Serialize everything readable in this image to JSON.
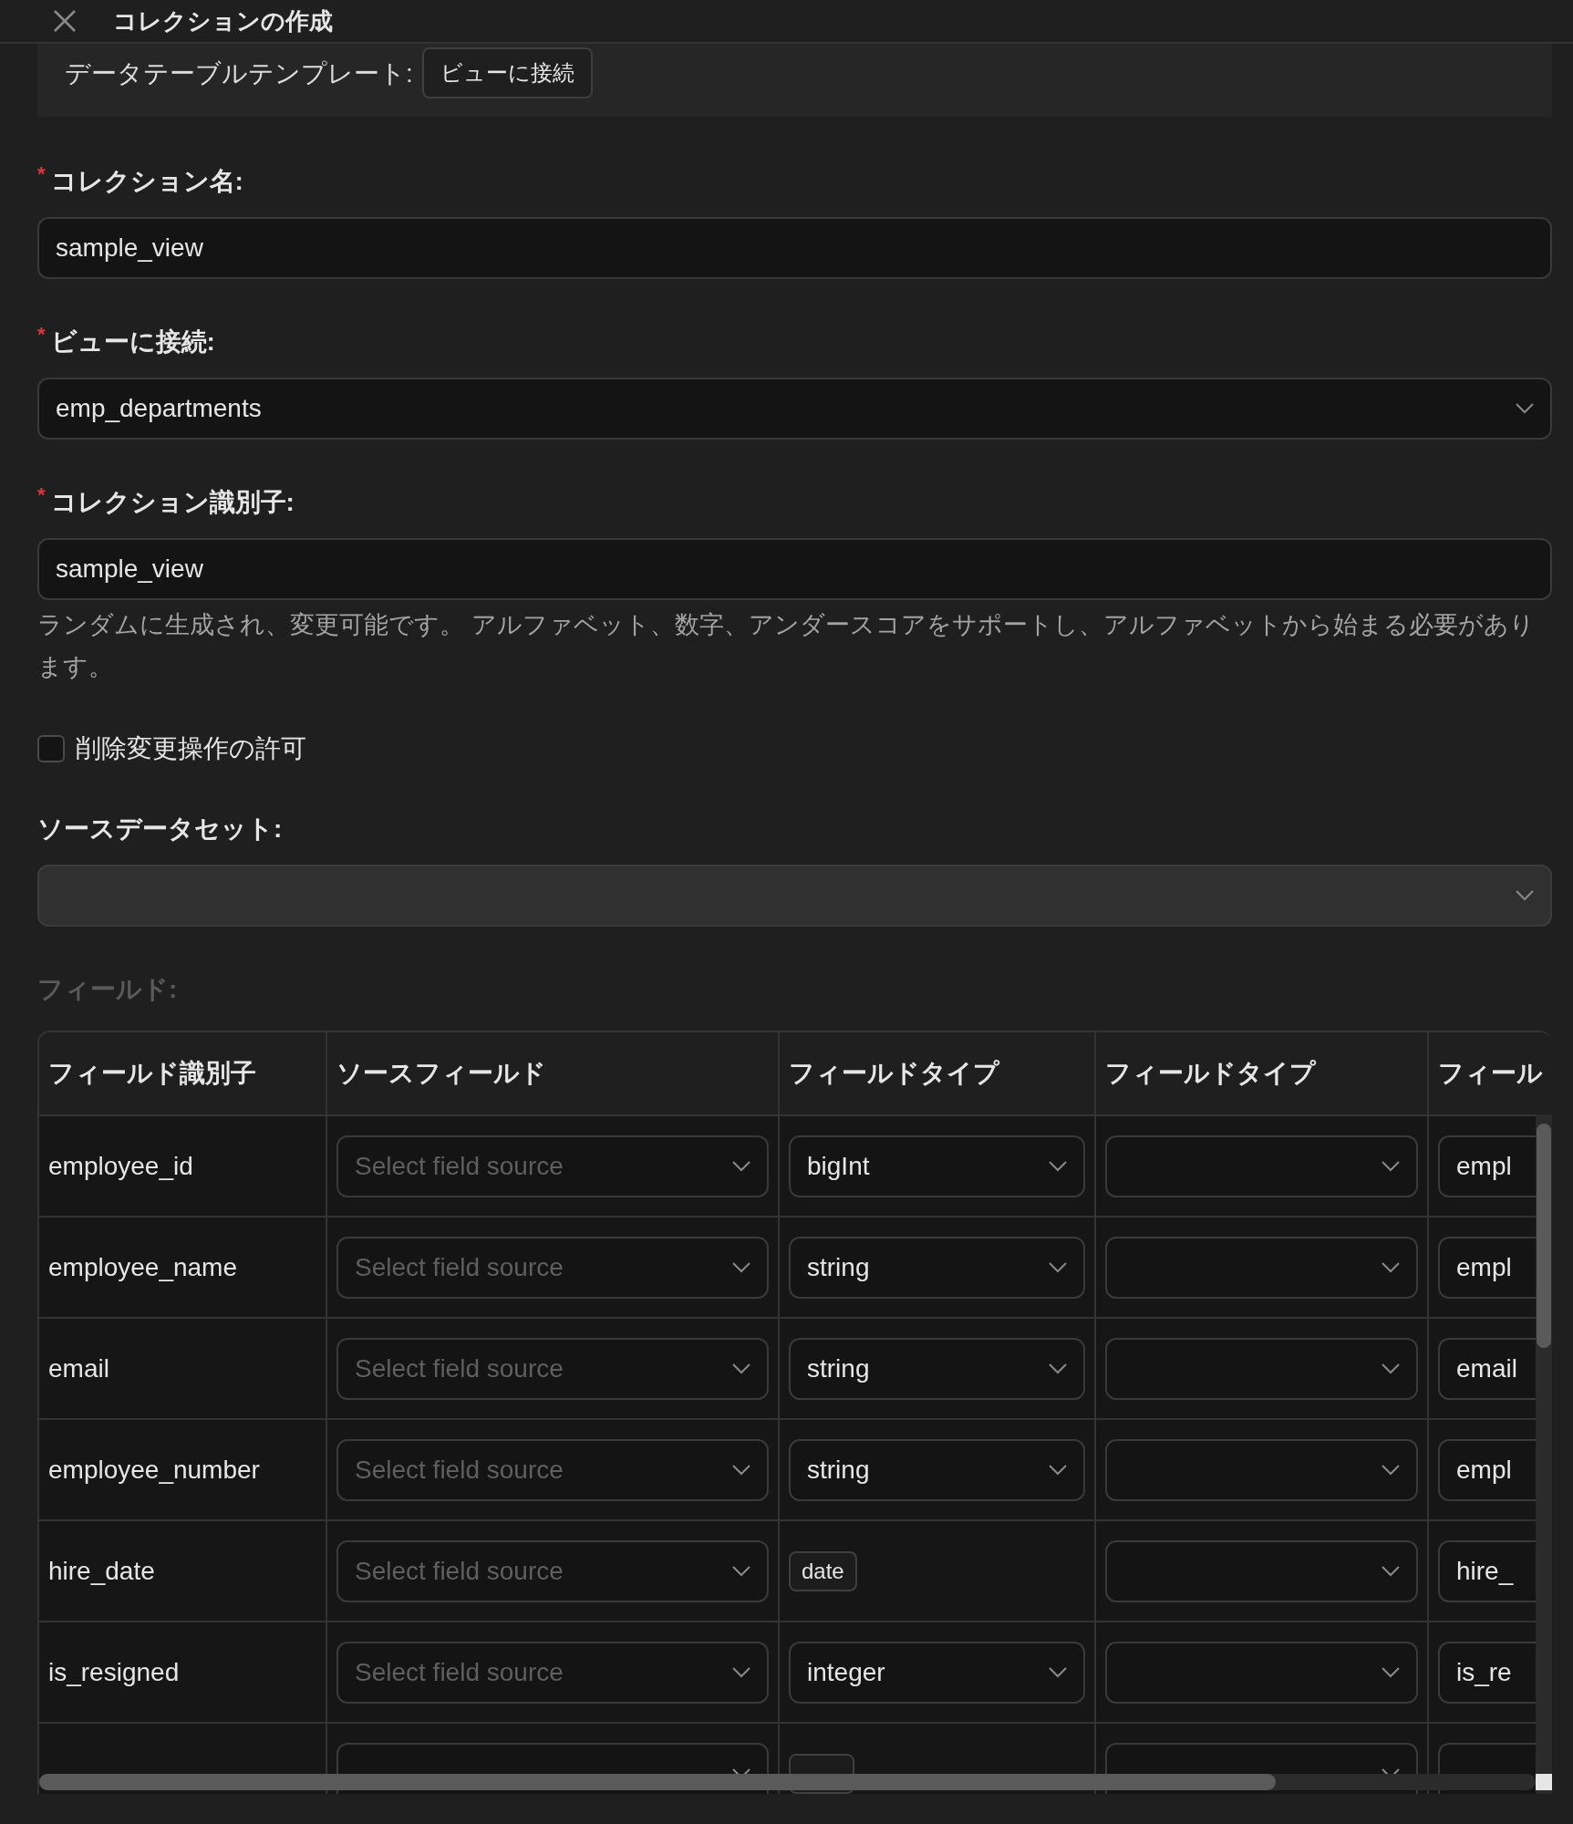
{
  "dialog": {
    "title": "コレクションの作成"
  },
  "template": {
    "label": "データテーブルテンプレート:",
    "tag": "ビューに接続"
  },
  "fields": [
    {
      "kind": "text",
      "label": "コレクション名:",
      "required": "*",
      "disabled": false,
      "value": "sample_view"
    },
    {
      "kind": "select",
      "label": "ビューに接続:",
      "required": "*",
      "disabled": false,
      "value": "emp_departments"
    },
    {
      "kind": "text",
      "label": "コレクション識別子:",
      "required": "*",
      "disabled": false,
      "value": "sample_view",
      "help": "ランダムに生成され、変更可能です。 アルファベット、数字、アンダースコアをサポートし、アルファベットから始まる必要があります。"
    },
    {
      "kind": "checkbox",
      "label": "削除変更操作の許可",
      "checked": false
    },
    {
      "kind": "select",
      "label": "ソースデータセット:",
      "disabled": true
    }
  ],
  "table": {
    "label": "フィールド:",
    "disabled": true,
    "columns": [
      "フィールド識別子",
      "ソースフィールド",
      "フィールドタイプ",
      "フィールドタイプ",
      "フィール"
    ],
    "rows": [
      {
        "identifier": "employee_id",
        "source": {
          "placeholder": "Select field source"
        },
        "type": {
          "kind": "select",
          "value": "bigInt"
        },
        "column_5": "empl"
      },
      {
        "identifier": "employee_name",
        "source": {
          "placeholder": "Select field source"
        },
        "type": {
          "kind": "select",
          "value": "string"
        },
        "column_5": "empl"
      },
      {
        "identifier": "email",
        "source": {
          "placeholder": "Select field source"
        },
        "type": {
          "kind": "select",
          "value": "string"
        },
        "column_5": "email"
      },
      {
        "identifier": "employee_number",
        "source": {
          "placeholder": "Select field source"
        },
        "type": {
          "kind": "select",
          "value": "string"
        },
        "column_5": "empl"
      },
      {
        "identifier": "hire_date",
        "source": {
          "placeholder": "Select field source"
        },
        "type": {
          "kind": "tag",
          "value": "date"
        },
        "column_5": "hire_"
      },
      {
        "identifier": "is_resigned",
        "source": {
          "placeholder": "Select field source"
        },
        "type": {
          "kind": "select",
          "value": "integer"
        },
        "column_5": "is_re"
      },
      {
        "kind": "cut"
      }
    ]
  }
}
